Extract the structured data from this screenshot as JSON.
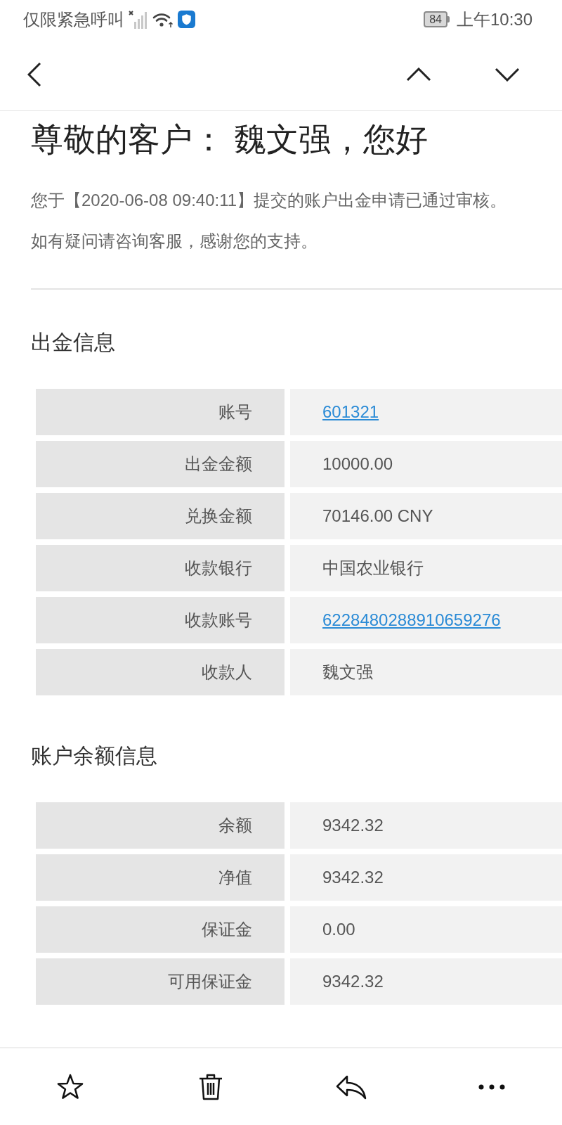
{
  "status_bar": {
    "label": "仅限紧急呼叫",
    "battery": "84",
    "time": "上午10:30"
  },
  "message": {
    "greeting": "尊敬的客户： 魏文强，您好",
    "paragraphs": [
      "您于【2020-06-08 09:40:11】提交的账户出金申请已通过审核。",
      "如有疑问请咨询客服，感谢您的支持。"
    ]
  },
  "sections": [
    {
      "heading": "出金信息",
      "rows": [
        {
          "label": "账号",
          "value": "601321",
          "kind": "link"
        },
        {
          "label": "出金金额",
          "value": "10000.00",
          "kind": "text"
        },
        {
          "label": "兑换金额",
          "value": "70146.00 CNY",
          "kind": "text"
        },
        {
          "label": "收款银行",
          "value": "中国农业银行",
          "kind": "text"
        },
        {
          "label": "收款账号",
          "value": "6228480288910659276",
          "kind": "link"
        },
        {
          "label": "收款人",
          "value": "魏文强",
          "kind": "text"
        }
      ]
    },
    {
      "heading": "账户余额信息",
      "rows": [
        {
          "label": "余额",
          "value": "9342.32",
          "kind": "text"
        },
        {
          "label": "净值",
          "value": "9342.32",
          "kind": "text"
        },
        {
          "label": "保证金",
          "value": "0.00",
          "kind": "text"
        },
        {
          "label": "可用保证金",
          "value": "9342.32",
          "kind": "text"
        }
      ]
    }
  ]
}
